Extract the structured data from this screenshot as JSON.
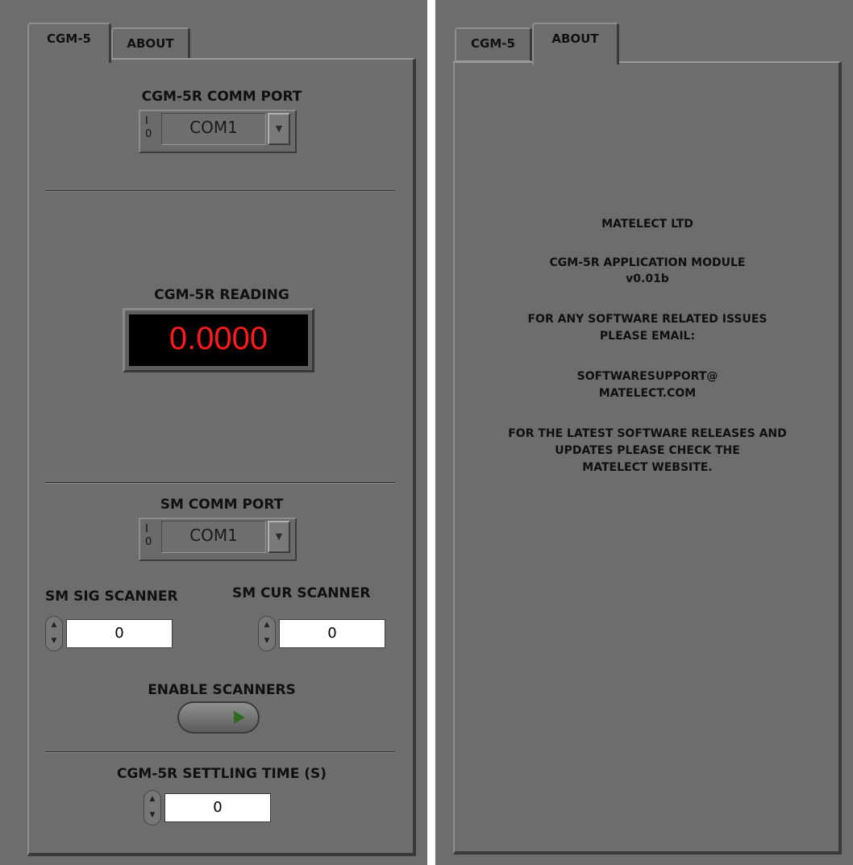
{
  "left": {
    "tabs": [
      {
        "label": "CGM-5",
        "active": true
      },
      {
        "label": "ABOUT",
        "active": false
      }
    ],
    "cgm_comm_port": {
      "label": "CGM-5R COMM PORT",
      "io_top": "I",
      "io_bottom": "0",
      "value": "COM1",
      "dropdown_glyph": "▼"
    },
    "reading": {
      "label": "CGM-5R READING",
      "value": "0.0000",
      "color": "#ff1a1a"
    },
    "sm_comm_port": {
      "label": "SM COMM PORT",
      "io_top": "I",
      "io_bottom": "0",
      "value": "COM1",
      "dropdown_glyph": "▼"
    },
    "sm_sig_scanner": {
      "label": "SM SIG SCANNER",
      "value": "0"
    },
    "sm_cur_scanner": {
      "label": "SM CUR SCANNER",
      "value": "0"
    },
    "enable_scanners": {
      "label": "ENABLE SCANNERS",
      "state": "off",
      "indicator_color": "#2e6b1e"
    },
    "settling_time": {
      "label": "CGM-5R SETTLING TIME (S)",
      "value": "0"
    },
    "stepper_glyphs": {
      "up": "▲",
      "down": "▼"
    }
  },
  "right": {
    "tabs": [
      {
        "label": "CGM-5",
        "active": false
      },
      {
        "label": "ABOUT",
        "active": true
      }
    ],
    "about_lines": [
      "MATELECT LTD",
      "CGM-5R APPLICATION MODULE",
      "v0.01b",
      "FOR ANY SOFTWARE RELATED ISSUES",
      "PLEASE EMAIL:",
      "SOFTWARESUPPORT@",
      "MATELECT.COM",
      "FOR THE LATEST SOFTWARE RELEASES AND",
      "UPDATES PLEASE CHECK THE",
      "MATELECT WEBSITE."
    ]
  },
  "colors": {
    "panel_bg": "#6d6d6d",
    "numeric_bg": "#ffffff",
    "display_bg": "#000000"
  }
}
